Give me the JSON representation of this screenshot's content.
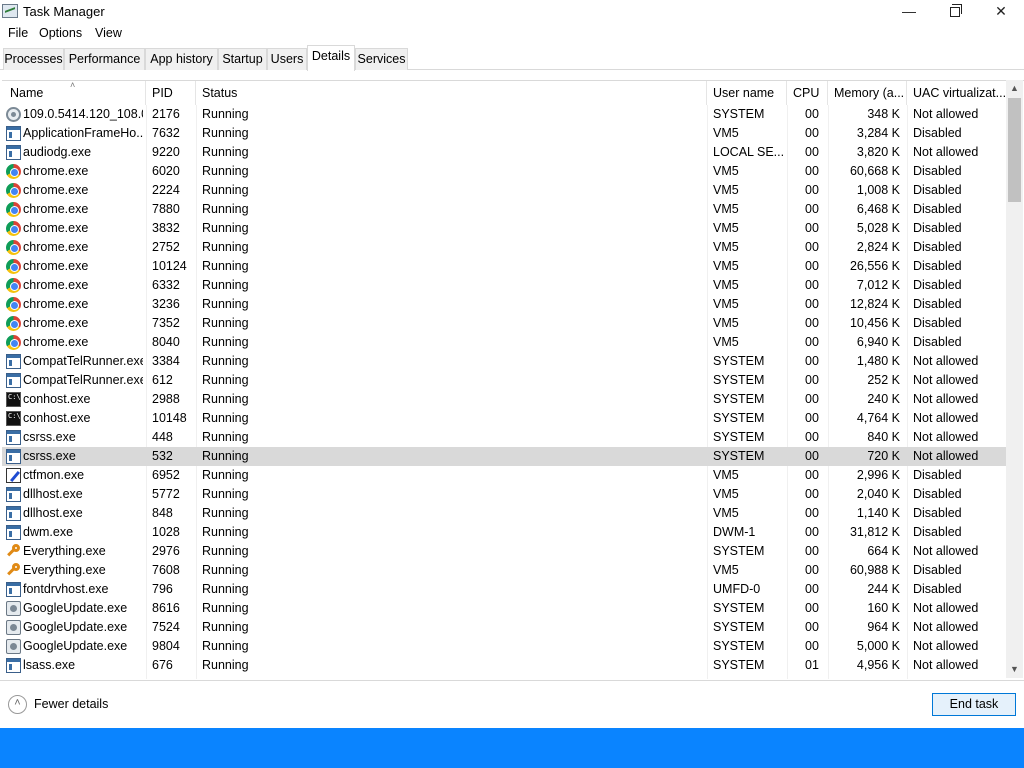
{
  "window": {
    "title": "Task Manager",
    "minimize": "—",
    "close": "✕"
  },
  "menu": [
    "File",
    "Options",
    "View"
  ],
  "tabs": [
    "Processes",
    "Performance",
    "App history",
    "Startup",
    "Users",
    "Details",
    "Services"
  ],
  "active_tab": "Details",
  "columns": [
    "Name",
    "PID",
    "Status",
    "User name",
    "CPU",
    "Memory (a...",
    "UAC virtualizat..."
  ],
  "rows": [
    {
      "icon": "gear-icon",
      "name": "109.0.5414.120_108.0...",
      "pid": "2176",
      "status": "Running",
      "user": "SYSTEM",
      "cpu": "00",
      "mem": "348 K",
      "uac": "Not allowed"
    },
    {
      "icon": "window-icon",
      "name": "ApplicationFrameHo...",
      "pid": "7632",
      "status": "Running",
      "user": "VM5",
      "cpu": "00",
      "mem": "3,284 K",
      "uac": "Disabled"
    },
    {
      "icon": "window-icon",
      "name": "audiodg.exe",
      "pid": "9220",
      "status": "Running",
      "user": "LOCAL SE...",
      "cpu": "00",
      "mem": "3,820 K",
      "uac": "Not allowed"
    },
    {
      "icon": "chrome-icon",
      "name": "chrome.exe",
      "pid": "6020",
      "status": "Running",
      "user": "VM5",
      "cpu": "00",
      "mem": "60,668 K",
      "uac": "Disabled"
    },
    {
      "icon": "chrome-icon",
      "name": "chrome.exe",
      "pid": "2224",
      "status": "Running",
      "user": "VM5",
      "cpu": "00",
      "mem": "1,008 K",
      "uac": "Disabled"
    },
    {
      "icon": "chrome-icon",
      "name": "chrome.exe",
      "pid": "7880",
      "status": "Running",
      "user": "VM5",
      "cpu": "00",
      "mem": "6,468 K",
      "uac": "Disabled"
    },
    {
      "icon": "chrome-icon",
      "name": "chrome.exe",
      "pid": "3832",
      "status": "Running",
      "user": "VM5",
      "cpu": "00",
      "mem": "5,028 K",
      "uac": "Disabled"
    },
    {
      "icon": "chrome-icon",
      "name": "chrome.exe",
      "pid": "2752",
      "status": "Running",
      "user": "VM5",
      "cpu": "00",
      "mem": "2,824 K",
      "uac": "Disabled"
    },
    {
      "icon": "chrome-icon",
      "name": "chrome.exe",
      "pid": "10124",
      "status": "Running",
      "user": "VM5",
      "cpu": "00",
      "mem": "26,556 K",
      "uac": "Disabled"
    },
    {
      "icon": "chrome-icon",
      "name": "chrome.exe",
      "pid": "6332",
      "status": "Running",
      "user": "VM5",
      "cpu": "00",
      "mem": "7,012 K",
      "uac": "Disabled"
    },
    {
      "icon": "chrome-icon",
      "name": "chrome.exe",
      "pid": "3236",
      "status": "Running",
      "user": "VM5",
      "cpu": "00",
      "mem": "12,824 K",
      "uac": "Disabled"
    },
    {
      "icon": "chrome-icon",
      "name": "chrome.exe",
      "pid": "7352",
      "status": "Running",
      "user": "VM5",
      "cpu": "00",
      "mem": "10,456 K",
      "uac": "Disabled"
    },
    {
      "icon": "chrome-icon",
      "name": "chrome.exe",
      "pid": "8040",
      "status": "Running",
      "user": "VM5",
      "cpu": "00",
      "mem": "6,940 K",
      "uac": "Disabled"
    },
    {
      "icon": "window-icon",
      "name": "CompatTelRunner.exe",
      "pid": "3384",
      "status": "Running",
      "user": "SYSTEM",
      "cpu": "00",
      "mem": "1,480 K",
      "uac": "Not allowed"
    },
    {
      "icon": "window-icon",
      "name": "CompatTelRunner.exe",
      "pid": "612",
      "status": "Running",
      "user": "SYSTEM",
      "cpu": "00",
      "mem": "252 K",
      "uac": "Not allowed"
    },
    {
      "icon": "console-icon",
      "name": "conhost.exe",
      "pid": "2988",
      "status": "Running",
      "user": "SYSTEM",
      "cpu": "00",
      "mem": "240 K",
      "uac": "Not allowed"
    },
    {
      "icon": "console-icon",
      "name": "conhost.exe",
      "pid": "10148",
      "status": "Running",
      "user": "SYSTEM",
      "cpu": "00",
      "mem": "4,764 K",
      "uac": "Not allowed"
    },
    {
      "icon": "window-icon",
      "name": "csrss.exe",
      "pid": "448",
      "status": "Running",
      "user": "SYSTEM",
      "cpu": "00",
      "mem": "840 K",
      "uac": "Not allowed"
    },
    {
      "icon": "window-icon",
      "name": "csrss.exe",
      "pid": "532",
      "status": "Running",
      "user": "SYSTEM",
      "cpu": "00",
      "mem": "720 K",
      "uac": "Not allowed",
      "selected": true
    },
    {
      "icon": "pen-icon",
      "name": "ctfmon.exe",
      "pid": "6952",
      "status": "Running",
      "user": "VM5",
      "cpu": "00",
      "mem": "2,996 K",
      "uac": "Disabled"
    },
    {
      "icon": "window-icon",
      "name": "dllhost.exe",
      "pid": "5772",
      "status": "Running",
      "user": "VM5",
      "cpu": "00",
      "mem": "2,040 K",
      "uac": "Disabled"
    },
    {
      "icon": "window-icon",
      "name": "dllhost.exe",
      "pid": "848",
      "status": "Running",
      "user": "VM5",
      "cpu": "00",
      "mem": "1,140 K",
      "uac": "Disabled"
    },
    {
      "icon": "window-icon",
      "name": "dwm.exe",
      "pid": "1028",
      "status": "Running",
      "user": "DWM-1",
      "cpu": "00",
      "mem": "31,812 K",
      "uac": "Disabled"
    },
    {
      "icon": "key-icon",
      "name": "Everything.exe",
      "pid": "2976",
      "status": "Running",
      "user": "SYSTEM",
      "cpu": "00",
      "mem": "664 K",
      "uac": "Not allowed"
    },
    {
      "icon": "key-icon",
      "name": "Everything.exe",
      "pid": "7608",
      "status": "Running",
      "user": "VM5",
      "cpu": "00",
      "mem": "60,988 K",
      "uac": "Disabled"
    },
    {
      "icon": "window-icon",
      "name": "fontdrvhost.exe",
      "pid": "796",
      "status": "Running",
      "user": "UMFD-0",
      "cpu": "00",
      "mem": "244 K",
      "uac": "Disabled"
    },
    {
      "icon": "disk-icon",
      "name": "GoogleUpdate.exe",
      "pid": "8616",
      "status": "Running",
      "user": "SYSTEM",
      "cpu": "00",
      "mem": "160 K",
      "uac": "Not allowed"
    },
    {
      "icon": "disk-icon",
      "name": "GoogleUpdate.exe",
      "pid": "7524",
      "status": "Running",
      "user": "SYSTEM",
      "cpu": "00",
      "mem": "964 K",
      "uac": "Not allowed"
    },
    {
      "icon": "disk-icon",
      "name": "GoogleUpdate.exe",
      "pid": "9804",
      "status": "Running",
      "user": "SYSTEM",
      "cpu": "00",
      "mem": "5,000 K",
      "uac": "Not allowed"
    },
    {
      "icon": "window-icon",
      "name": "lsass.exe",
      "pid": "676",
      "status": "Running",
      "user": "SYSTEM",
      "cpu": "01",
      "mem": "4,956 K",
      "uac": "Not allowed"
    }
  ],
  "footer": {
    "fewer_details": "Fewer details",
    "end_task": "End task"
  },
  "colors": {
    "accent": "#0078d7",
    "taskbar": "#0a84ff",
    "selected_row": "#d9d9d9"
  }
}
